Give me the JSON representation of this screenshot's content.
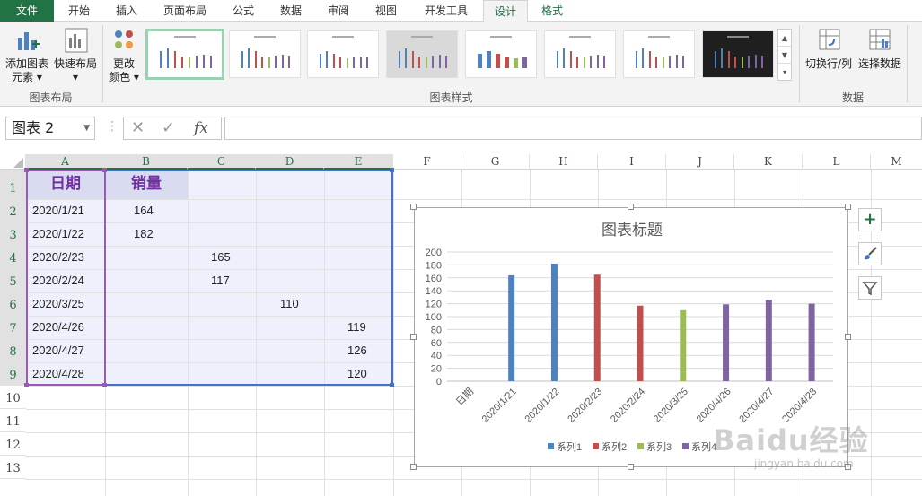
{
  "ribbon_tabs": [
    "文件",
    "开始",
    "插入",
    "页面布局",
    "公式",
    "数据",
    "审阅",
    "视图",
    "开发工具",
    "设计",
    "格式"
  ],
  "ribbon": {
    "add_element": [
      "添加图表",
      "元素"
    ],
    "quick_layout": "快速布局",
    "change_colors": [
      "更改",
      "颜色"
    ],
    "group_layout": "图表布局",
    "group_styles": "图表样式",
    "switch_rowcol": "切换行/列",
    "select_data": "选择数据",
    "group_data": "数据"
  },
  "formula_bar": {
    "name_box": "图表 2",
    "fx": "fx"
  },
  "columns": [
    "A",
    "B",
    "C",
    "D",
    "E",
    "F",
    "G",
    "H",
    "I",
    "J",
    "K",
    "L",
    "M"
  ],
  "rows": [
    "1",
    "2",
    "3",
    "4",
    "5",
    "6",
    "7",
    "8",
    "9",
    "10",
    "11",
    "12",
    "13"
  ],
  "sheet": {
    "header_a": "日期",
    "header_b": "销量",
    "dates": [
      "2020/1/21",
      "2020/1/22",
      "2020/2/23",
      "2020/2/24",
      "2020/3/25",
      "2020/4/26",
      "2020/4/27",
      "2020/4/28"
    ],
    "b_values": [
      "164",
      "182",
      "",
      "",
      "",
      "",
      "",
      ""
    ],
    "c_values": [
      "",
      "",
      "165",
      "117",
      "",
      "",
      "",
      ""
    ],
    "d_values": [
      "",
      "",
      "",
      "",
      "110",
      "",
      "",
      ""
    ],
    "e_values": [
      "",
      "",
      "",
      "",
      "",
      "119",
      "126",
      "120"
    ]
  },
  "colors": {
    "series1": "#4f81bd",
    "series2": "#c0504d",
    "series3": "#9bbb59",
    "series4": "#8064a2",
    "excel_green": "#217346"
  },
  "chart_data": {
    "type": "bar",
    "title": "图表标题",
    "categories": [
      "日期",
      "2020/1/21",
      "2020/1/22",
      "2020/2/23",
      "2020/2/24",
      "2020/3/25",
      "2020/4/26",
      "2020/4/27",
      "2020/4/28"
    ],
    "series": [
      {
        "name": "系列1",
        "values": [
          null,
          164,
          182,
          null,
          null,
          null,
          null,
          null,
          null
        ]
      },
      {
        "name": "系列2",
        "values": [
          null,
          null,
          null,
          165,
          117,
          null,
          null,
          null,
          null
        ]
      },
      {
        "name": "系列3",
        "values": [
          null,
          null,
          null,
          null,
          null,
          110,
          null,
          null,
          null
        ]
      },
      {
        "name": "系列4",
        "values": [
          null,
          null,
          null,
          null,
          null,
          null,
          119,
          126,
          120
        ]
      }
    ],
    "yticks": [
      0,
      20,
      40,
      60,
      80,
      100,
      120,
      140,
      160,
      180,
      200
    ],
    "ylim": [
      0,
      200
    ],
    "grid": true,
    "legend": "bottom"
  },
  "chart_side_buttons": [
    "plus-icon",
    "brush-icon",
    "filter-icon"
  ],
  "watermark": {
    "logo": "Baidu经验",
    "url": "jingyan.baidu.com"
  }
}
